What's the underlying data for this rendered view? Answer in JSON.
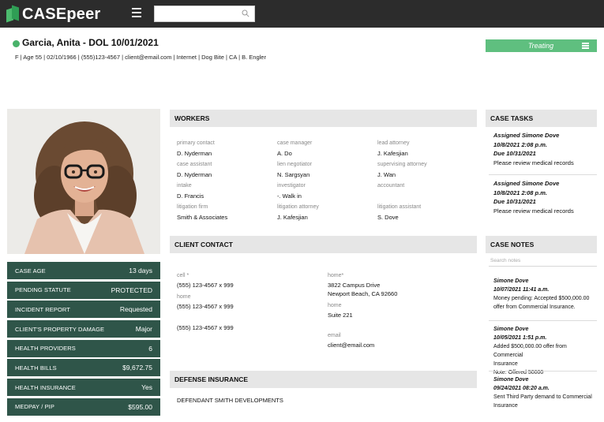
{
  "app": {
    "logo_text": "CASEpeer"
  },
  "search": {
    "placeholder": ""
  },
  "header": {
    "title": "Garcia, Anita - DOL 10/01/2021",
    "meta": "F | Age 55 | 02/10/1966 | (555)123-4567 | client@email.com | Internet | Dog Bite | CA | B. Engler",
    "status_label": "Treating",
    "status_color": "#5fbf7f"
  },
  "stats": [
    {
      "label": "CASE AGE",
      "value": "13 days"
    },
    {
      "label": "PENDING STATUTE",
      "value": "PROTECTED"
    },
    {
      "label": "INCIDENT REPORT",
      "value": "Requested"
    },
    {
      "label": "CLIENT'S PROPERTY DAMAGE",
      "value": "Major"
    },
    {
      "label": "HEALTH PROVIDERS",
      "value": "6"
    },
    {
      "label": "HEALTH BILLS",
      "value": "$9,672.75"
    },
    {
      "label": "HEALTH INSURANCE",
      "value": "Yes"
    },
    {
      "label": "MEDPAY / PIP",
      "value": "$595.00"
    }
  ],
  "workers": {
    "title": "WORKERS",
    "items": [
      {
        "label": "primary contact",
        "value": "D. Nyderman"
      },
      {
        "label": "case manager",
        "value": "A. Do"
      },
      {
        "label": "lead attorney",
        "value": "J. Kafesjian"
      },
      {
        "label": "case assistant",
        "value": "D. Nyderman"
      },
      {
        "label": "lien negotiator",
        "value": "N. Sargsyan"
      },
      {
        "label": "supervising attorney",
        "value": "J. Wan"
      },
      {
        "label": "intake",
        "value": "D. Francis"
      },
      {
        "label": "investigator",
        "value": "-. Walk in"
      },
      {
        "label": "accountant",
        "value": ""
      },
      {
        "label": "litigation firm",
        "value": "Smith & Associates"
      },
      {
        "label": "litigation attorney",
        "value": "J. Kafesjian"
      },
      {
        "label": "litigation assistant",
        "value": "S. Dove"
      }
    ]
  },
  "client_contact": {
    "title": "CLIENT CONTACT",
    "cell_label": "cell *",
    "cell_value": "(555) 123-4567 x 999",
    "home_label": "home",
    "home_value": "(555) 123-4567 x 999",
    "extra_phone": "(555) 123-4567 x 999",
    "address_label": "home*",
    "address_line1": "3822 Campus Drive",
    "address_line2": "Newport Beach, CA 92660",
    "address2_label": "home",
    "address2_value": "Suite 221",
    "email_label": "email",
    "email_value": "client@email.com"
  },
  "defense": {
    "title": "DEFENSE INSURANCE",
    "value": "DEFENDANT SMITH DEVELOPMENTS"
  },
  "case_tasks": {
    "title": "CASE TASKS",
    "items": [
      {
        "assigned": "Assigned Simone Dove",
        "date": "10/8/2021 2:08 p.m.",
        "due": "Due 10/31/2021",
        "text": "Please review medical records"
      },
      {
        "assigned": "Assigned Simone Dove",
        "date": "10/8/2021 2:08 p.m.",
        "due": "Due 10/31/2021",
        "text": "Please review medical records"
      }
    ]
  },
  "case_notes": {
    "title": "CASE NOTES",
    "search_placeholder": "Search notes",
    "items": [
      {
        "author": "Simone Dove",
        "date": "10/07/2021 11:41 a.m.",
        "line1": "Money pending: Accepted $500,000.00",
        "line2": "offer from Commercial Insurance.",
        "line3": ""
      },
      {
        "author": "Simone Dove",
        "date": "10/05/2021 1:51 p.m.",
        "line1": "Added $500,000.00 offer from Commercial",
        "line2": "Insurance",
        "line3": "Note: Offered 50000"
      },
      {
        "author": "Simone Dove",
        "date": "09/24/2021 08:20 a.m.",
        "line1": "Sent Third Party demand to Commercial",
        "line2": "Insurance",
        "line3": ""
      }
    ]
  }
}
